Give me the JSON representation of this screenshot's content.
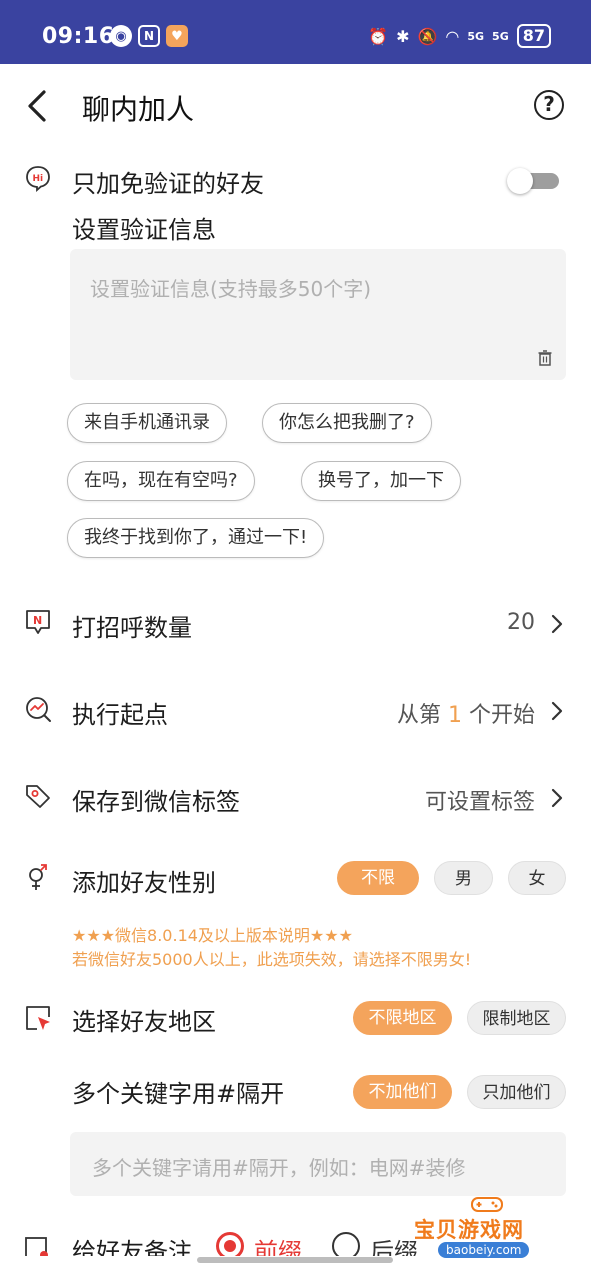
{
  "status_bar": {
    "time": "09:16",
    "left_icons": [
      "app-icon-dark",
      "nfc-icon",
      "app-icon-heart"
    ],
    "right_icons": [
      "alarm-icon",
      "bluetooth-icon",
      "mute-icon",
      "wifi-icon",
      "signal-5g-icon",
      "signal-5g-icon"
    ],
    "signal_label": "5G",
    "battery": "87"
  },
  "header": {
    "title": "聊内加人",
    "help_icon": "?"
  },
  "verify_free": {
    "label": "只加免验证的好友",
    "icon": "hi-icon",
    "toggle_on": false
  },
  "verify_message": {
    "label": "设置验证信息",
    "placeholder": "设置验证信息(支持最多50个字)"
  },
  "quick_phrases": [
    "来自手机通讯录",
    "你怎么把我删了?",
    "在吗，现在有空吗?",
    "换号了，加一下",
    "我终于找到你了，通过一下!"
  ],
  "greet_count": {
    "label": "打招呼数量",
    "value": "20"
  },
  "start_point": {
    "label": "执行起点",
    "prefix": "从第",
    "number": "1",
    "suffix": "个开始"
  },
  "wechat_tag": {
    "label": "保存到微信标签",
    "value": "可设置标签"
  },
  "gender": {
    "label": "添加好友性别",
    "options": [
      "不限",
      "男",
      "女"
    ],
    "selected": "不限"
  },
  "notice": {
    "line1": "★★★微信8.0.14及以上版本说明★★★",
    "line2": "若微信好友5000人以上，此选项失效，请选择不限男女!"
  },
  "region": {
    "label": "选择好友地区",
    "options": [
      "不限地区",
      "限制地区"
    ],
    "selected": "不限地区"
  },
  "keywords": {
    "label": "多个关键字用#隔开",
    "options": [
      "不加他们",
      "只加他们"
    ],
    "selected": "不加他们",
    "placeholder": "多个关键字请用#隔开，例如：电网#装修"
  },
  "remark": {
    "label": "给好友备注",
    "options": [
      "前缀",
      "后缀"
    ]
  },
  "watermark": {
    "text": "宝贝游戏网",
    "url": "baobeiy.com"
  },
  "colors": {
    "accent": "#f4a45c",
    "status_bar": "#3a43a0",
    "accent_text": "#f0a050"
  }
}
